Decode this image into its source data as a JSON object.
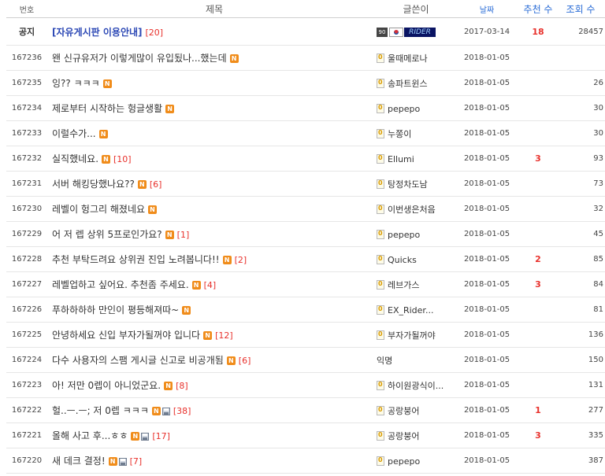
{
  "headers": {
    "num": "번호",
    "title": "제목",
    "author": "글쓴이",
    "date": "날짜",
    "recommend": "추천 수",
    "views": "조회 수"
  },
  "notice": {
    "num": "공지",
    "title": "[자유게시판 이용안내]",
    "comments": "[20]",
    "author_level": "90",
    "author_name_image": "RIDER",
    "date": "2017-03-14",
    "recommend": "18",
    "views": "28457"
  },
  "new_label": "N",
  "rows": [
    {
      "num": "167236",
      "title": "왠 신규유저가 이렇게많이 유입됬나...했는데",
      "comments": "",
      "author": "울때메로나",
      "date": "2018-01-05",
      "recommend": "",
      "views": ""
    },
    {
      "num": "167235",
      "title": "잉?? ㅋㅋㅋ",
      "comments": "",
      "author": "송파트윈스",
      "date": "2018-01-05",
      "recommend": "",
      "views": "26"
    },
    {
      "num": "167234",
      "title": "제로부터 시작하는 헝글생활",
      "comments": "",
      "author": "pepepo",
      "date": "2018-01-05",
      "recommend": "",
      "views": "30"
    },
    {
      "num": "167233",
      "title": "이럴수가...",
      "comments": "",
      "author": "누쫑이",
      "date": "2018-01-05",
      "recommend": "",
      "views": "30"
    },
    {
      "num": "167232",
      "title": "실직했네요.",
      "comments": "[10]",
      "author": "Ellumi",
      "date": "2018-01-05",
      "recommend": "3",
      "views": "93"
    },
    {
      "num": "167231",
      "title": "서버 해킹당했나요??",
      "comments": "[6]",
      "author": "탕정차도남",
      "date": "2018-01-05",
      "recommend": "",
      "views": "73"
    },
    {
      "num": "167230",
      "title": "레벨이 헝그리 해졌네요",
      "comments": "",
      "author": "이번생은처음",
      "date": "2018-01-05",
      "recommend": "",
      "views": "32"
    },
    {
      "num": "167229",
      "title": "어 저 렙 상위 5프로인가요?",
      "comments": "[1]",
      "author": "pepepo",
      "date": "2018-01-05",
      "recommend": "",
      "views": "45"
    },
    {
      "num": "167228",
      "title": "추천 부탁드려요 상위권 진입 노려봅니다!!",
      "comments": "[2]",
      "author": "Quicks",
      "date": "2018-01-05",
      "recommend": "2",
      "views": "85"
    },
    {
      "num": "167227",
      "title": "레벨업하고 싶어요. 추천좀 주세요.",
      "comments": "[4]",
      "author": "레브가스",
      "date": "2018-01-05",
      "recommend": "3",
      "views": "84"
    },
    {
      "num": "167226",
      "title": "푸하하하하 만인이 평등해져따~",
      "comments": "",
      "author": "EX_Rider...",
      "date": "2018-01-05",
      "recommend": "",
      "views": "81"
    },
    {
      "num": "167225",
      "title": "안녕하세요 신입 부자가될꺼야 입니다",
      "comments": "[12]",
      "author": "부자가될꺼야",
      "date": "2018-01-05",
      "recommend": "",
      "views": "136"
    },
    {
      "num": "167224",
      "title": "다수 사용자의 스팸 게시글 신고로 비공개됨",
      "comments": "[6]",
      "author": "익명",
      "date": "2018-01-05",
      "recommend": "",
      "views": "150",
      "no_level": true
    },
    {
      "num": "167223",
      "title": "아! 저만 0렙이 아니었군요.",
      "comments": "[8]",
      "author": "하이원광식이...",
      "date": "2018-01-05",
      "recommend": "",
      "views": "131"
    },
    {
      "num": "167222",
      "title": "헐..ㅡ.ㅡ; 저 0렙 ㅋㅋㅋ",
      "comments": "[38]",
      "author": "공랑붕어",
      "date": "2018-01-05",
      "recommend": "1",
      "views": "277",
      "file": true
    },
    {
      "num": "167221",
      "title": "올해 사고 후...ㅎㅎ",
      "comments": "[17]",
      "author": "공랑붕어",
      "date": "2018-01-05",
      "recommend": "3",
      "views": "335",
      "file": true
    },
    {
      "num": "167220",
      "title": "새 데크 결정!",
      "comments": "[7]",
      "author": "pepepo",
      "date": "2018-01-05",
      "recommend": "",
      "views": "387",
      "file": true
    }
  ]
}
